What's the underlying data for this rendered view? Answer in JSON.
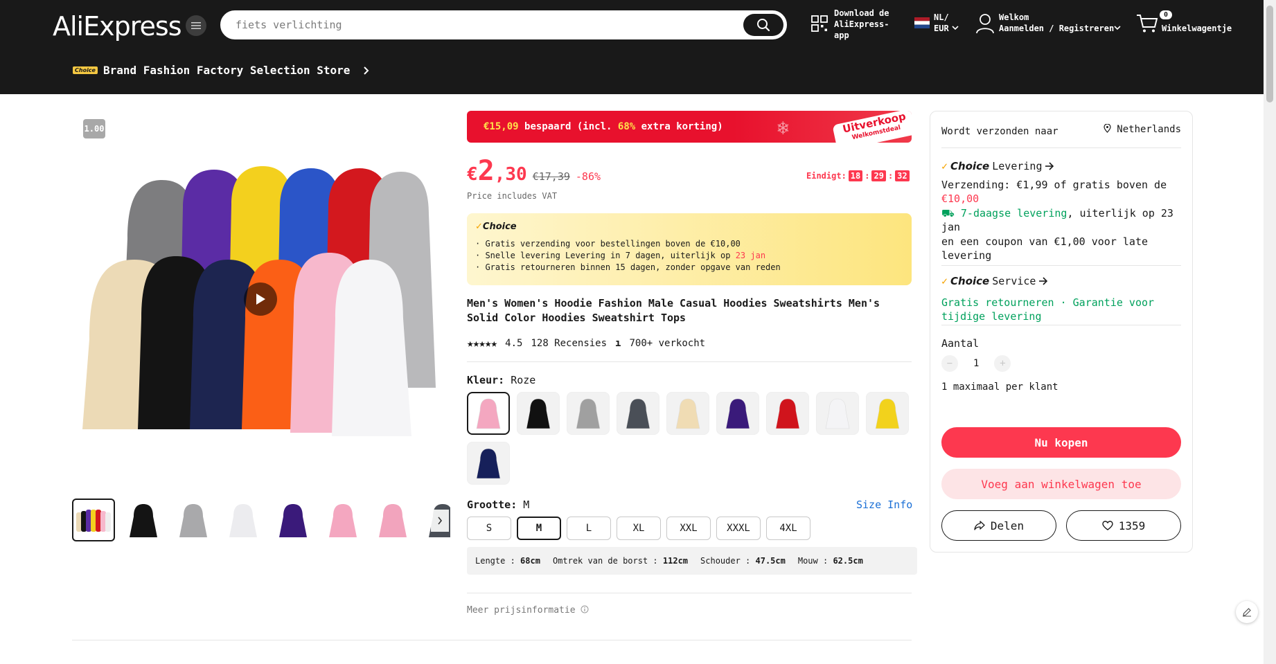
{
  "header": {
    "logo": "AliExpress",
    "search_placeholder": "fiets verlichting",
    "download_line1": "Download de",
    "download_line2": "AliExpress-",
    "download_line3": "app",
    "locale_line1": "NL/",
    "locale_line2": "EUR",
    "welcome": "Welkom",
    "signin": "Aanmelden / Registreren",
    "cart_count": "0",
    "cart_label": "Winkelwagentje"
  },
  "store": {
    "badge": "Choice",
    "name": "Brand Fashion Factory Selection Store"
  },
  "gallery": {
    "zoom": "1.00",
    "thumbnails": [
      "multi",
      "black",
      "gray",
      "white",
      "purple",
      "pink",
      "pink2",
      "charcoal"
    ]
  },
  "promo": {
    "saved_amount": "€15,09",
    "saved_text": "bespaard (incl.",
    "extra_pct": "68%",
    "extra_text": "extra korting)",
    "tag_line1": "Uitverkoop",
    "tag_line2": "Welkomstdeal"
  },
  "price": {
    "currency": "€",
    "integer": "2",
    "decimal": ",30",
    "old": "€17,39",
    "discount": "-86%",
    "vat_note": "Price includes VAT",
    "countdown_label": "Eindigt:",
    "hh": "18",
    "mm": "29",
    "ss": "32"
  },
  "choice_box": {
    "logo": "Choice",
    "line1": "· Gratis verzending voor bestellingen boven de €10,00",
    "line2_a": "· Snelle levering Levering in 7 dagen, uiterlijk op",
    "line2_b": "23 jan",
    "line3": "· Gratis retourneren  binnen 15 dagen, zonder opgave van reden"
  },
  "product": {
    "title": "Men's Women's Hoodie Fashion Male Casual Hoodies Sweatshirts Men's Solid Color Hoodies Sweatshirt Tops",
    "stars": "★★★★★",
    "rating": "4.5",
    "reviews": "128 Recensies",
    "separator": "ı",
    "sold": "700+ verkocht"
  },
  "color": {
    "label": "Kleur:",
    "selected": "Roze",
    "options": [
      {
        "name": "pink",
        "hex": "#f4a7c0"
      },
      {
        "name": "black",
        "hex": "#111111"
      },
      {
        "name": "gray",
        "hex": "#a0a0a0"
      },
      {
        "name": "charcoal",
        "hex": "#4a4f57"
      },
      {
        "name": "beige",
        "hex": "#f0dcb4"
      },
      {
        "name": "purple",
        "hex": "#3a1a7a"
      },
      {
        "name": "red",
        "hex": "#d0141c"
      },
      {
        "name": "white",
        "hex": "#f4f4f6"
      },
      {
        "name": "yellow",
        "hex": "#f2d21c"
      },
      {
        "name": "navy",
        "hex": "#16205a"
      }
    ]
  },
  "size": {
    "label": "Grootte:",
    "selected": "M",
    "info_link": "Size Info",
    "options": [
      "S",
      "M",
      "L",
      "XL",
      "XXL",
      "XXXL",
      "4XL"
    ],
    "measure_length_label": "Lengte :",
    "measure_length": "68cm",
    "measure_chest_label": "Omtrek van de borst :",
    "measure_chest": "112cm",
    "measure_shoulder_label": "Schouder :",
    "measure_shoulder": "47.5cm",
    "measure_sleeve_label": "Mouw :",
    "measure_sleeve": "62.5cm"
  },
  "more_price": "Meer prijsinformatie",
  "panel": {
    "ship_to_label": "Wordt verzonden naar",
    "ship_country": "Netherlands",
    "choice_delivery_logo": "Choice",
    "choice_delivery_label": "Levering",
    "shipping_line_a": "Verzending: €1,99  of gratis boven de",
    "shipping_line_b": "€10,00",
    "delivery_green": "7-daagse levering",
    "delivery_rest": ", uiterlijk op 23 jan",
    "coupon": "en een coupon van €1,00 voor late levering",
    "choice_service_logo": "Choice",
    "choice_service_label": "Service",
    "service_text": "Gratis retourneren · Garantie voor tijdige levering",
    "qty_label": "Aantal",
    "qty_minus": "−",
    "qty_value": "1",
    "qty_plus": "+",
    "max_note": "1 maximaal per klant",
    "buy_now": "Nu kopen",
    "add_to_cart": "Voeg aan winkelwagen toe",
    "share": "Delen",
    "wishlist_count": "1359"
  },
  "colors": {
    "accent": "#fd384f",
    "header_bg": "#191919",
    "green": "#00a15c",
    "link": "#1a6fd6"
  }
}
